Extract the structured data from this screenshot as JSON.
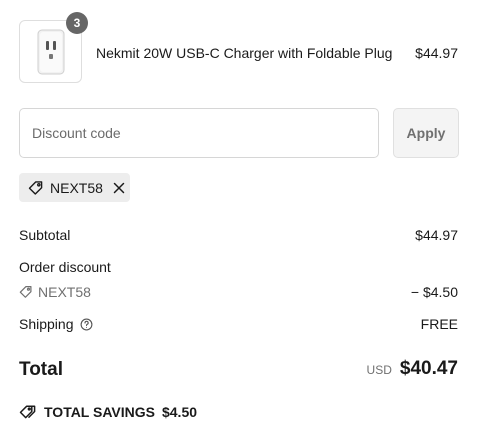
{
  "line_item": {
    "quantity": "3",
    "name": "Nekmit 20W USB-C Charger with Foldable Plug",
    "price": "$44.97"
  },
  "discount": {
    "placeholder": "Discount code",
    "apply_label": "Apply",
    "applied_code": "NEXT58"
  },
  "summary": {
    "subtotal_label": "Subtotal",
    "subtotal_value": "$44.97",
    "order_discount_label": "Order discount",
    "discount_code": "NEXT58",
    "discount_value": "− $4.50",
    "shipping_label": "Shipping",
    "shipping_value": "FREE",
    "total_label": "Total",
    "total_currency": "USD",
    "total_value": "$40.47",
    "savings_label": "TOTAL SAVINGS",
    "savings_value": "$4.50"
  },
  "icons": {
    "tag": "tag-icon",
    "close": "close-icon",
    "info": "info-icon",
    "savings": "savings-tag-icon",
    "product": "charger-image"
  }
}
